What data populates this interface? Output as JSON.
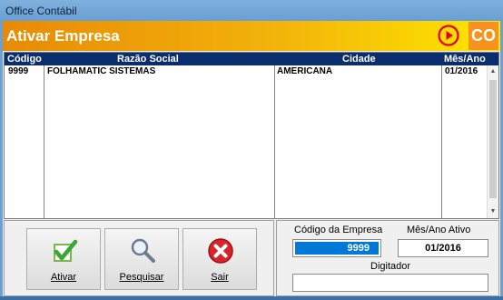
{
  "window": {
    "title": "Office Contábil"
  },
  "header": {
    "title": "Ativar Empresa",
    "badge": "CO",
    "colors": {
      "orange": "#e88a06",
      "yellow": "#ffe600",
      "red": "#e3001b"
    }
  },
  "grid": {
    "columns": [
      "Código",
      "Razão Social",
      "Cidade",
      "Mês/Ano"
    ],
    "rows": [
      {
        "codigo": "9999",
        "razao": "FOLHAMATIC SISTEMAS",
        "cidade": "AMERICANA",
        "mes_ano": "01/2016"
      }
    ]
  },
  "toolbar": {
    "ativar_label": "Ativar",
    "pesquisar_label": "Pesquisar",
    "sair_label": "Sair",
    "icons": [
      "check-icon",
      "magnifier-icon",
      "close-icon"
    ]
  },
  "form": {
    "codigo_label": "Código da Empresa",
    "codigo_value": "9999",
    "mes_ano_label": "Mês/Ano  Ativo",
    "mes_ano_value": "01/2016",
    "digitador_label": "Digitador",
    "digitador_value": ""
  }
}
